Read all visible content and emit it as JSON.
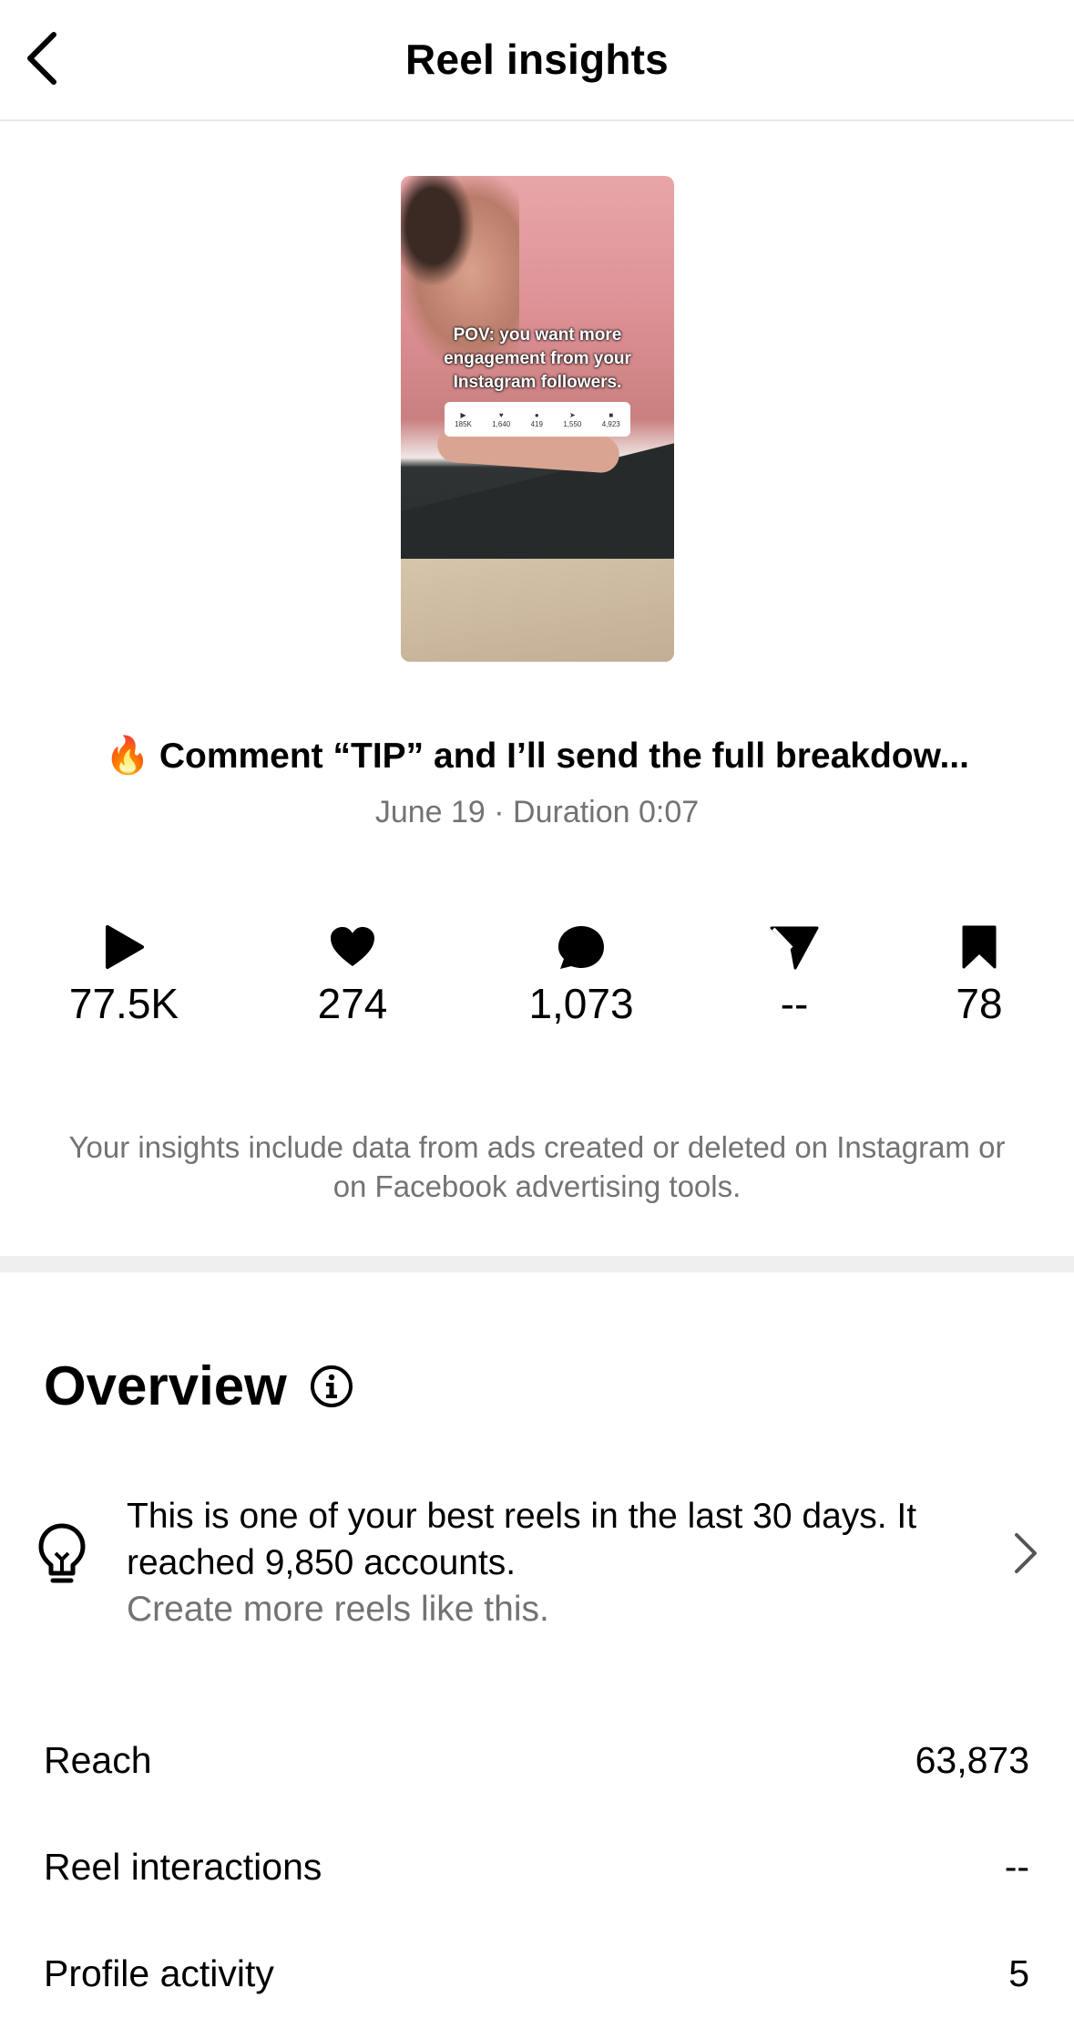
{
  "header": {
    "title": "Reel insights"
  },
  "thumbnail": {
    "caption": "POV: you want more engagement from your Instagram followers.",
    "stats": [
      "185K",
      "1,640",
      "419",
      "1,550",
      "4,923"
    ]
  },
  "post": {
    "emoji": "🔥",
    "title": "Comment “TIP” and I’ll send the full breakdow...",
    "meta": "June 19 · Duration 0:07"
  },
  "stats": {
    "plays": "77.5K",
    "likes": "274",
    "comments": "1,073",
    "shares": "--",
    "saves": "78"
  },
  "notice": "Your insights include data from ads created or deleted on Instagram or on Facebook advertising tools.",
  "overview": {
    "title": "Overview",
    "tip_line": "This is one of your best reels in the last 30 days. It reached 9,850 accounts.",
    "tip_sub": "Create more reels like this."
  },
  "metrics": [
    {
      "label": "Reach",
      "value": "63,873"
    },
    {
      "label": "Reel interactions",
      "value": "--"
    },
    {
      "label": "Profile activity",
      "value": "5"
    }
  ]
}
